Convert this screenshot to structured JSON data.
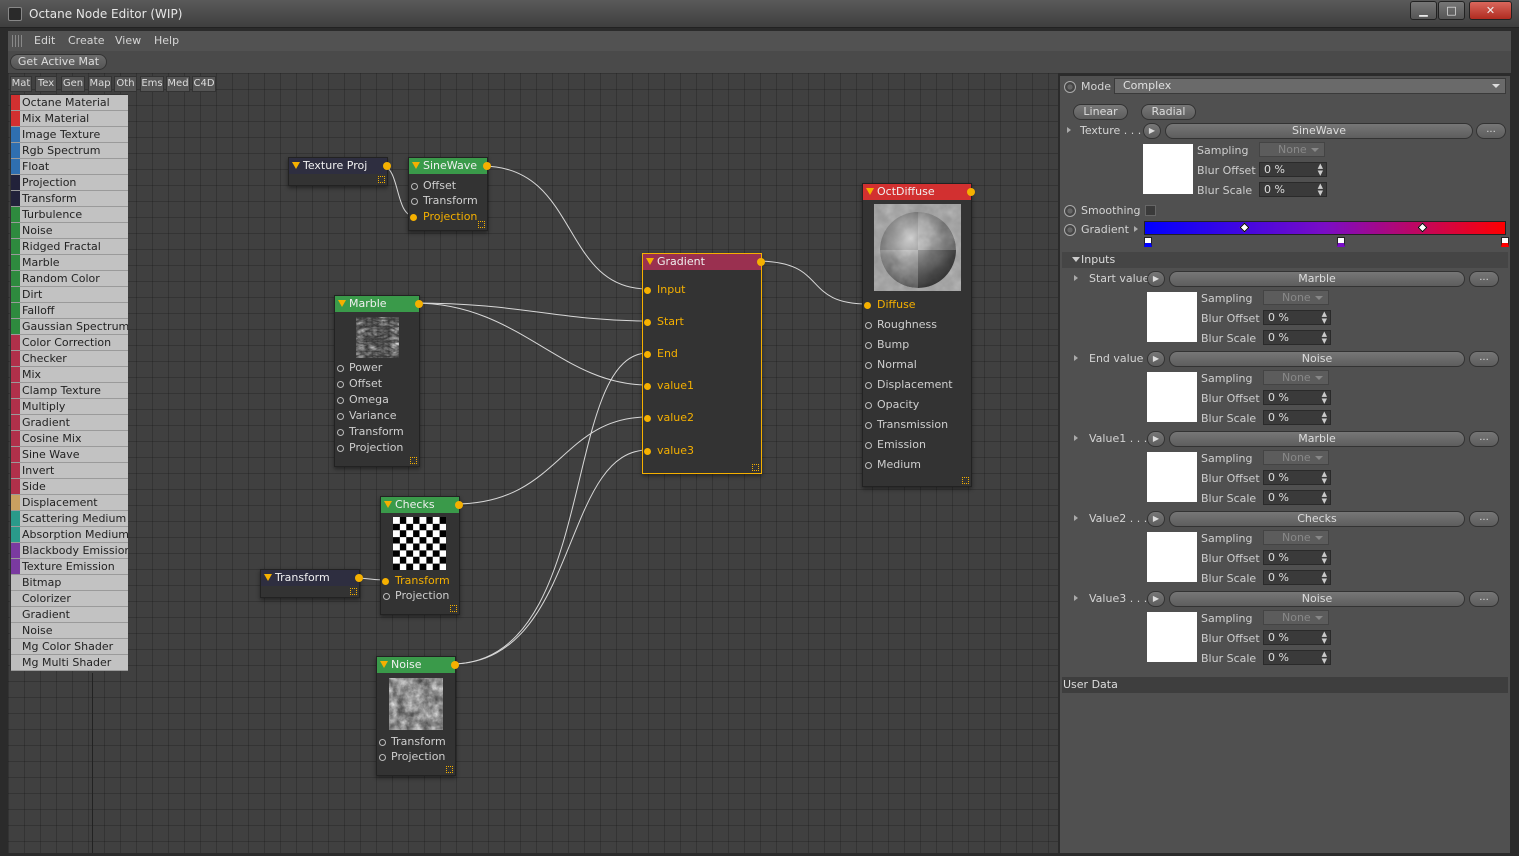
{
  "window": {
    "title": "Octane Node Editor (WIP)",
    "minimize": "▁",
    "maximize": "□",
    "close": "✕"
  },
  "menu": {
    "items": [
      "Edit",
      "Create",
      "View",
      "Help"
    ]
  },
  "toolbar": {
    "get_active_mat": "Get Active Mat"
  },
  "category_tabs": [
    "Mat",
    "Tex",
    "Gen",
    "Map",
    "Oth",
    "Ems",
    "Med",
    "C4D"
  ],
  "node_list": [
    {
      "label": "Octane Material",
      "color": "#d23030"
    },
    {
      "label": "Mix Material",
      "color": "#d23030"
    },
    {
      "label": "Image Texture",
      "color": "#2f6fb0"
    },
    {
      "label": "Rgb Spectrum",
      "color": "#2f6fb0"
    },
    {
      "label": "Float",
      "color": "#2f6fb0"
    },
    {
      "label": "Projection",
      "color": "#22223a"
    },
    {
      "label": "Transform",
      "color": "#22223a"
    },
    {
      "label": "Turbulence",
      "color": "#2e8a3e"
    },
    {
      "label": "Noise",
      "color": "#2e8a3e"
    },
    {
      "label": "Ridged Fractal",
      "color": "#2e8a3e"
    },
    {
      "label": "Marble",
      "color": "#2e8a3e"
    },
    {
      "label": "Random Color",
      "color": "#2e8a3e"
    },
    {
      "label": "Dirt",
      "color": "#2e8a3e"
    },
    {
      "label": "Falloff",
      "color": "#2e8a3e"
    },
    {
      "label": "Gaussian Spectrum",
      "color": "#2e8a3e"
    },
    {
      "label": "Color Correction",
      "color": "#b0304a"
    },
    {
      "label": "Checker",
      "color": "#b0304a"
    },
    {
      "label": "Mix",
      "color": "#b0304a"
    },
    {
      "label": "Clamp Texture",
      "color": "#b0304a"
    },
    {
      "label": "Multiply",
      "color": "#b0304a"
    },
    {
      "label": "Gradient",
      "color": "#b0304a"
    },
    {
      "label": "Cosine Mix",
      "color": "#b0304a"
    },
    {
      "label": "Sine Wave",
      "color": "#b0304a"
    },
    {
      "label": "Invert",
      "color": "#b0304a"
    },
    {
      "label": "Side",
      "color": "#b0304a"
    },
    {
      "label": "Displacement",
      "color": "#c8a060"
    },
    {
      "label": "Scattering Medium",
      "color": "#2a9a8a"
    },
    {
      "label": "Absorption Medium",
      "color": "#2a9a8a"
    },
    {
      "label": "Blackbody Emission",
      "color": "#7a3aa0"
    },
    {
      "label": "Texture Emission",
      "color": "#7a3aa0"
    },
    {
      "label": "Bitmap",
      "color": "#bdbdbd"
    },
    {
      "label": "Colorizer",
      "color": "#bdbdbd"
    },
    {
      "label": "Gradient",
      "color": "#bdbdbd"
    },
    {
      "label": "Noise",
      "color": "#bdbdbd"
    },
    {
      "label": "Mg Color Shader",
      "color": "#bdbdbd"
    },
    {
      "label": "Mg Multi Shader",
      "color": "#bdbdbd"
    }
  ],
  "nodes": {
    "texture_proj": {
      "title": "Texture Proj"
    },
    "sinewave": {
      "title": "SineWave",
      "ports": [
        "Offset",
        "Transform",
        "Projection"
      ]
    },
    "marble": {
      "title": "Marble",
      "ports": [
        "Power",
        "Offset",
        "Omega",
        "Variance",
        "Transform",
        "Projection"
      ]
    },
    "checks": {
      "title": "Checks",
      "ports": [
        "Transform",
        "Projection"
      ]
    },
    "transform": {
      "title": "Transform"
    },
    "noise": {
      "title": "Noise",
      "ports": [
        "Transform",
        "Projection"
      ]
    },
    "gradient": {
      "title": "Gradient",
      "ports": [
        "Input",
        "Start",
        "End",
        "value1",
        "value2",
        "value3"
      ]
    },
    "octdiffuse": {
      "title": "OctDiffuse",
      "ports": [
        "Diffuse",
        "Roughness",
        "Bump",
        "Normal",
        "Displacement",
        "Opacity",
        "Transmission",
        "Emission",
        "Medium"
      ]
    }
  },
  "node_colors": {
    "texture": "#3a9a4a",
    "gradient": "#9a3050",
    "material": "#d23030",
    "utility": "#2e2e40",
    "wire": "#d8d8d8",
    "active_port": "#f5b000"
  },
  "props": {
    "mode_label": "Mode",
    "mode_value": "Complex",
    "linear": "Linear",
    "radial": "Radial",
    "texture_label": "Texture . . .",
    "texture_value": "SineWave",
    "smoothing_label": "Smoothing",
    "gradient_label": "Gradient",
    "inputs_label": "Inputs",
    "user_data": "User Data",
    "sampling_label": "Sampling",
    "blur_offset_label": "Blur Offset",
    "blur_scale_label": "Blur Scale",
    "sampling_value": "None",
    "percent_value": "0 %",
    "dots": "...",
    "arrow_btn": "▶",
    "gradient_colors": [
      "#0000ff",
      "#7a0cc6",
      "#ff0000"
    ],
    "inputs": [
      {
        "label": "Start value",
        "value": "Marble"
      },
      {
        "label": "End value",
        "value": "Noise"
      },
      {
        "label": "Value1 . . .",
        "value": "Marble"
      },
      {
        "label": "Value2 . . .",
        "value": "Checks"
      },
      {
        "label": "Value3 . . .",
        "value": "Noise"
      }
    ]
  }
}
